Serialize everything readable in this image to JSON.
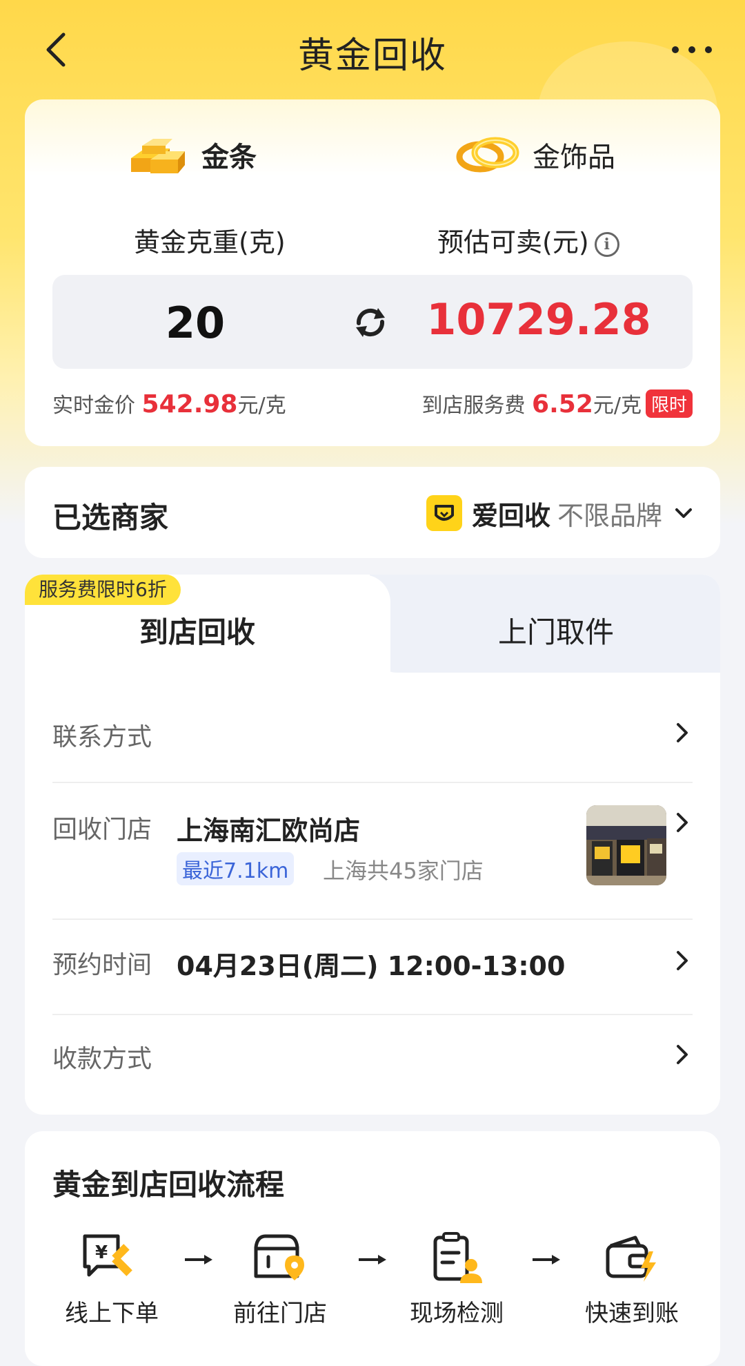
{
  "header": {
    "title": "黄金回收"
  },
  "price_card": {
    "tabs": [
      {
        "label": "金条",
        "icon": "gold-bar-icon",
        "active": true
      },
      {
        "label": "金饰品",
        "icon": "gold-rings-icon",
        "active": false
      }
    ],
    "weight_label": "黄金克重(克)",
    "estimate_label": "预估可卖(元)",
    "weight_value": "20",
    "estimate_value": "10729.28",
    "realtime_label": "实时金价",
    "realtime_price": "542.98",
    "realtime_unit": "元/克",
    "service_fee_label": "到店服务费",
    "service_fee": "6.52",
    "service_fee_unit": "元/克",
    "limited_tag": "限时"
  },
  "merchant": {
    "title": "已选商家",
    "name": "爱回收",
    "brand_note": "不限品牌"
  },
  "recycle": {
    "promo_tag": "服务费限时6折",
    "tabs": [
      {
        "label": "到店回收",
        "active": true
      },
      {
        "label": "上门取件",
        "active": false
      }
    ],
    "contact_label": "联系方式",
    "store_label": "回收门店",
    "store_name": "上海南汇欧尚店",
    "distance": "最近7.1km",
    "store_count": "上海共45家门店",
    "time_label": "预约时间",
    "time_value": "04月23日(周二) 12:00-13:00",
    "payment_label": "收款方式"
  },
  "process": {
    "title": "黄金到店回收流程",
    "steps": [
      {
        "label": "线上下单",
        "icon": "online-order-icon"
      },
      {
        "label": "前往门店",
        "icon": "go-to-store-icon"
      },
      {
        "label": "现场检测",
        "icon": "onsite-check-icon"
      },
      {
        "label": "快速到账",
        "icon": "fast-payment-icon"
      }
    ]
  },
  "colors": {
    "accent_yellow": "#ffd84a",
    "price_red": "#e8303a",
    "tag_blue": "#3a64d8"
  }
}
